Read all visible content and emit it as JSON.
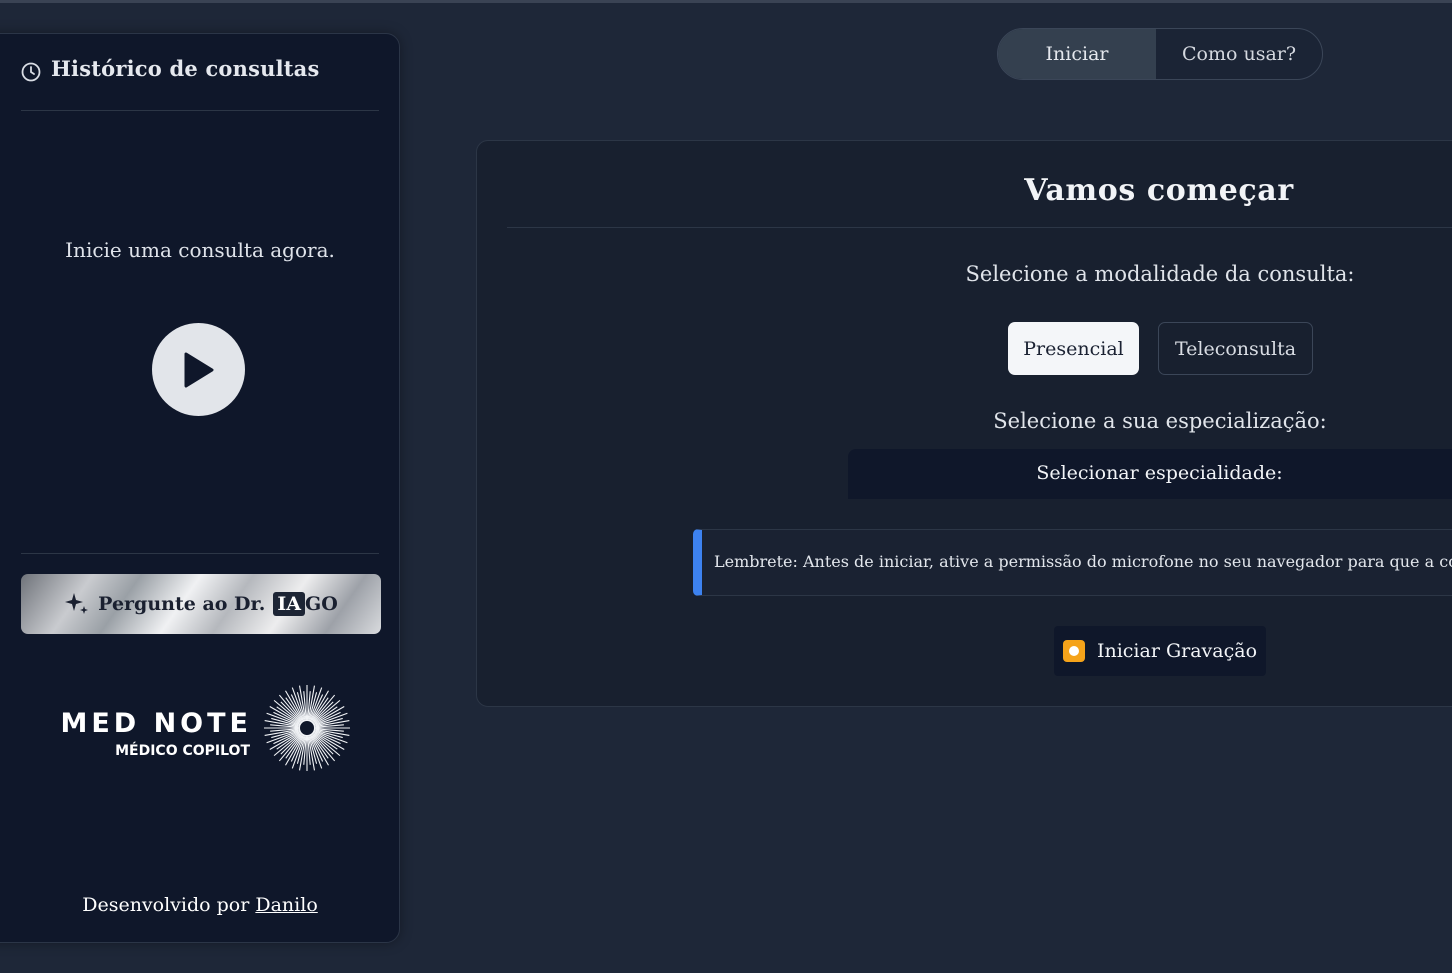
{
  "sidebar": {
    "title": "Histórico de consultas",
    "empty_message": "Inicie uma consulta agora.",
    "ask_button": {
      "prefix": "Pergunte ao Dr.",
      "highlight": "IA",
      "suffix": "GO"
    },
    "logo": {
      "name": "MED NOTE",
      "tagline": "MÉDICO COPILOT"
    },
    "footer": {
      "text": "Desenvolvido por",
      "author": "Danilo"
    }
  },
  "top_tabs": [
    {
      "label": "Iniciar",
      "active": true
    },
    {
      "label": "Como usar?",
      "active": false
    }
  ],
  "main": {
    "title": "Vamos começar",
    "modality_label": "Selecione a modalidade da consulta:",
    "modality_options": [
      {
        "label": "Presencial",
        "selected": true
      },
      {
        "label": "Teleconsulta",
        "selected": false
      }
    ],
    "specialization_label": "Selecione a sua especialização:",
    "specialization_select": "Selecionar especialidade:",
    "reminder": "Lembrete: Antes de iniciar, ative a permissão do microfone no seu navegador para que a consulta possa ser gravada.",
    "record_button": "Iniciar Gravação"
  },
  "colors": {
    "background": "#1e2738",
    "sidebar_bg": "#0f172a",
    "accent_blue": "#3d82f0",
    "record_orange": "#f5a31a"
  },
  "icons": [
    "clock-icon",
    "play-icon",
    "sparkle-icon",
    "sunburst-logo-icon",
    "record-icon"
  ]
}
